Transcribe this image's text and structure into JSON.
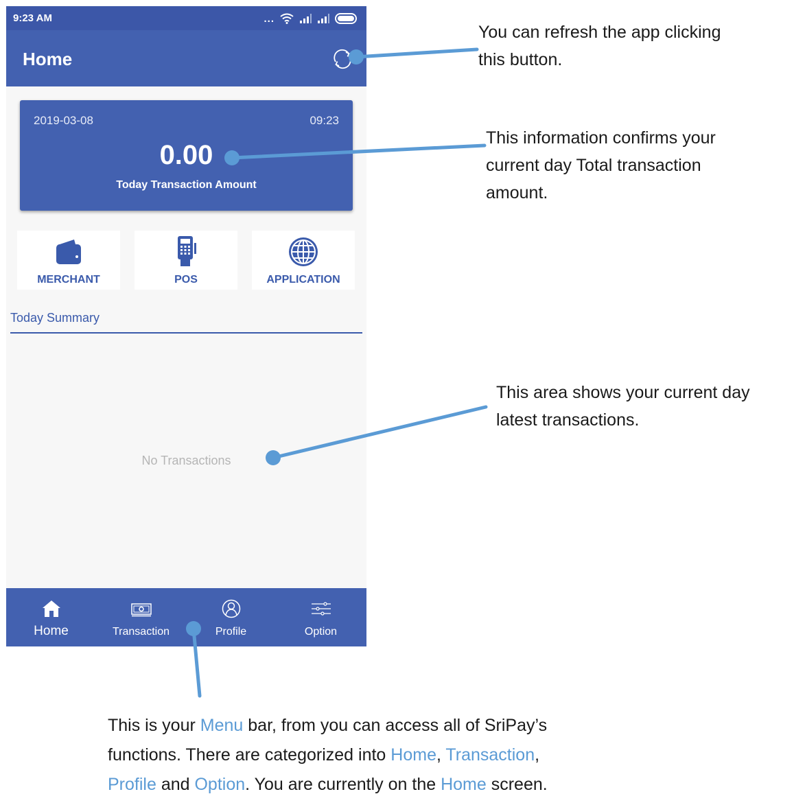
{
  "status_bar": {
    "time": "9:23 AM",
    "dots": "..."
  },
  "app_bar": {
    "title": "Home",
    "refresh_icon": "refresh-icon"
  },
  "amount_card": {
    "date": "2019-03-08",
    "time": "09:23",
    "amount": "0.00",
    "label": "Today Transaction Amount"
  },
  "quick_actions": [
    {
      "label": "MERCHANT",
      "icon": "wallet-icon"
    },
    {
      "label": "POS",
      "icon": "pos-terminal-icon"
    },
    {
      "label": "APPLICATION",
      "icon": "globe-icon"
    }
  ],
  "summary": {
    "title": "Today Summary",
    "empty_text": "No Transactions"
  },
  "bottom_nav": [
    {
      "label": "Home",
      "icon": "home-icon",
      "active": true
    },
    {
      "label": "Transaction",
      "icon": "cash-icon",
      "active": false
    },
    {
      "label": "Profile",
      "icon": "profile-icon",
      "active": false
    },
    {
      "label": "Option",
      "icon": "sliders-icon",
      "active": false
    }
  ],
  "annotations": {
    "refresh": {
      "line1": "You can refresh the app clicking",
      "line2": "this button."
    },
    "amount": {
      "line1": "This information confirms your",
      "line2": "current day Total transaction",
      "line3": "amount."
    },
    "area": {
      "line1": "This area shows your current day",
      "line2": "latest transactions."
    },
    "menu": {
      "p1": "This is your ",
      "menu": "Menu",
      "p2": " bar, from you can access all of SriPay’s",
      "p3": "functions. There are categorized into ",
      "home": "Home",
      "p4": ", ",
      "transaction": "Transaction",
      "p5": ",",
      "profile": "Profile",
      "p6": " and ",
      "option": "Option",
      "p7": ". You are currently on the ",
      "home2": "Home",
      "p8": " screen."
    }
  },
  "colors": {
    "primary": "#4361b0",
    "status_bar": "#3c57a8",
    "accent_text": "#3a5aab",
    "callout": "#5b9bd5"
  }
}
